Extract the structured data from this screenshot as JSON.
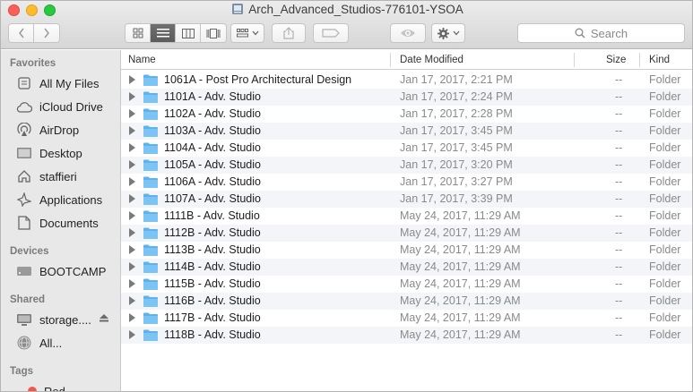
{
  "window": {
    "title": "Arch_Advanced_Studios-776101-YSOA"
  },
  "toolbar": {
    "search_placeholder": "Search"
  },
  "sidebar": {
    "favorites_header": "Favorites",
    "favorites": [
      {
        "label": "All My Files",
        "icon": "all-files-icon"
      },
      {
        "label": "iCloud Drive",
        "icon": "cloud-icon"
      },
      {
        "label": "AirDrop",
        "icon": "airdrop-icon"
      },
      {
        "label": "Desktop",
        "icon": "desktop-icon"
      },
      {
        "label": "staffieri",
        "icon": "home-icon"
      },
      {
        "label": "Applications",
        "icon": "applications-icon"
      },
      {
        "label": "Documents",
        "icon": "documents-icon"
      }
    ],
    "devices_header": "Devices",
    "devices": [
      {
        "label": "BOOTCAMP",
        "icon": "disk-icon"
      }
    ],
    "shared_header": "Shared",
    "shared": [
      {
        "label": "storage....",
        "icon": "server-icon"
      },
      {
        "label": "All...",
        "icon": "network-icon"
      }
    ],
    "tags_header": "Tags",
    "tags": [
      {
        "label": "Red",
        "color": "#f4564a"
      }
    ]
  },
  "list": {
    "columns": {
      "name": "Name",
      "date": "Date Modified",
      "size": "Size",
      "kind": "Kind"
    },
    "rows": [
      {
        "name": "1061A - Post Pro Architectural Design",
        "date": "Jan 17, 2017, 2:21 PM",
        "size": "--",
        "kind": "Folder"
      },
      {
        "name": "1101A - Adv. Studio",
        "date": "Jan 17, 2017, 2:24 PM",
        "size": "--",
        "kind": "Folder"
      },
      {
        "name": "1102A - Adv. Studio",
        "date": "Jan 17, 2017, 2:28 PM",
        "size": "--",
        "kind": "Folder"
      },
      {
        "name": "1103A - Adv. Studio",
        "date": "Jan 17, 2017, 3:45 PM",
        "size": "--",
        "kind": "Folder"
      },
      {
        "name": "1104A - Adv. Studio",
        "date": "Jan 17, 2017, 3:45 PM",
        "size": "--",
        "kind": "Folder"
      },
      {
        "name": "1105A - Adv. Studio",
        "date": "Jan 17, 2017, 3:20 PM",
        "size": "--",
        "kind": "Folder"
      },
      {
        "name": "1106A - Adv. Studio",
        "date": "Jan 17, 2017, 3:27 PM",
        "size": "--",
        "kind": "Folder"
      },
      {
        "name": "1107A - Adv. Studio",
        "date": "Jan 17, 2017, 3:39 PM",
        "size": "--",
        "kind": "Folder"
      },
      {
        "name": "1111B - Adv. Studio",
        "date": "May 24, 2017, 11:29 AM",
        "size": "--",
        "kind": "Folder"
      },
      {
        "name": "1112B - Adv. Studio",
        "date": "May 24, 2017, 11:29 AM",
        "size": "--",
        "kind": "Folder"
      },
      {
        "name": "1113B - Adv. Studio",
        "date": "May 24, 2017, 11:29 AM",
        "size": "--",
        "kind": "Folder"
      },
      {
        "name": "1114B - Adv. Studio",
        "date": "May 24, 2017, 11:29 AM",
        "size": "--",
        "kind": "Folder"
      },
      {
        "name": "1115B - Adv. Studio",
        "date": "May 24, 2017, 11:29 AM",
        "size": "--",
        "kind": "Folder"
      },
      {
        "name": "1116B - Adv. Studio",
        "date": "May 24, 2017, 11:29 AM",
        "size": "--",
        "kind": "Folder"
      },
      {
        "name": "1117B - Adv. Studio",
        "date": "May 24, 2017, 11:29 AM",
        "size": "--",
        "kind": "Folder"
      },
      {
        "name": "1118B - Adv. Studio",
        "date": "May 24, 2017, 11:29 AM",
        "size": "--",
        "kind": "Folder"
      }
    ]
  },
  "colors": {
    "folder": "#5eb3ee",
    "sidebar_bg": "#e8e8e8",
    "alt_row": "#f3f5f8"
  }
}
